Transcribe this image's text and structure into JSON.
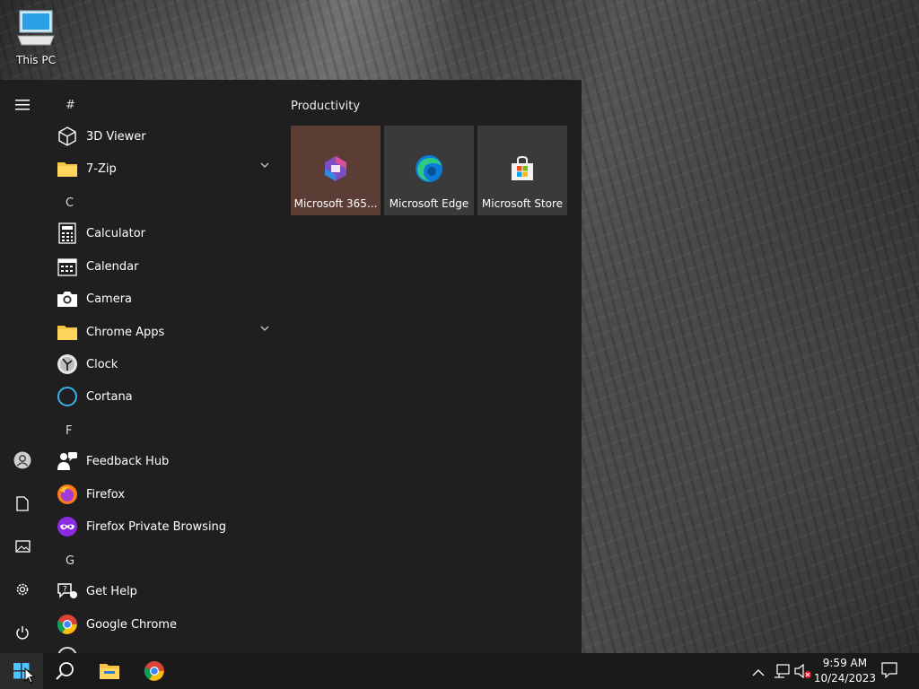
{
  "desktop": {
    "icons": [
      {
        "label": "This PC",
        "icon": "computer-icon"
      }
    ]
  },
  "start_menu": {
    "rail": {
      "items": [
        {
          "icon": "hamburger-icon"
        },
        {
          "icon": "user-icon"
        },
        {
          "icon": "document-icon"
        },
        {
          "icon": "pictures-icon"
        },
        {
          "icon": "gear-icon"
        },
        {
          "icon": "power-icon"
        }
      ]
    },
    "app_list": {
      "sections": [
        {
          "letter": "#",
          "apps": [
            {
              "label": "3D Viewer",
              "icon": "cube-icon"
            },
            {
              "label": "7-Zip",
              "icon": "folder-icon",
              "expandable": true
            }
          ]
        },
        {
          "letter": "C",
          "apps": [
            {
              "label": "Calculator",
              "icon": "calculator-icon"
            },
            {
              "label": "Calendar",
              "icon": "calendar-icon"
            },
            {
              "label": "Camera",
              "icon": "camera-icon"
            },
            {
              "label": "Chrome Apps",
              "icon": "folder-icon",
              "expandable": true
            },
            {
              "label": "Clock",
              "icon": "clock-icon"
            },
            {
              "label": "Cortana",
              "icon": "cortana-icon"
            }
          ]
        },
        {
          "letter": "F",
          "apps": [
            {
              "label": "Feedback Hub",
              "icon": "feedback-icon"
            },
            {
              "label": "Firefox",
              "icon": "firefox-icon"
            },
            {
              "label": "Firefox Private Browsing",
              "icon": "firefox-private-icon"
            }
          ]
        },
        {
          "letter": "G",
          "apps": [
            {
              "label": "Get Help",
              "icon": "help-icon"
            },
            {
              "label": "Google Chrome",
              "icon": "chrome-icon"
            }
          ]
        }
      ]
    },
    "tiles": {
      "group_title": "Productivity",
      "items": [
        {
          "label": "Microsoft 365...",
          "icon": "microsoft-365-icon",
          "bg": "#5c3d35"
        },
        {
          "label": "Microsoft Edge",
          "icon": "edge-icon",
          "bg": "#3a3a3a"
        },
        {
          "label": "Microsoft Store",
          "icon": "store-icon",
          "bg": "#3a3a3a"
        }
      ]
    }
  },
  "taskbar": {
    "buttons": [
      {
        "icon": "windows-start-icon"
      },
      {
        "icon": "search-icon"
      },
      {
        "icon": "file-explorer-icon"
      },
      {
        "icon": "chrome-icon"
      }
    ],
    "tray": {
      "icons": [
        "chevron-up-icon",
        "network-icon",
        "volume-muted-icon"
      ],
      "time": "9:59 AM",
      "date": "10/24/2023",
      "notification_icon": "notification-icon"
    }
  }
}
